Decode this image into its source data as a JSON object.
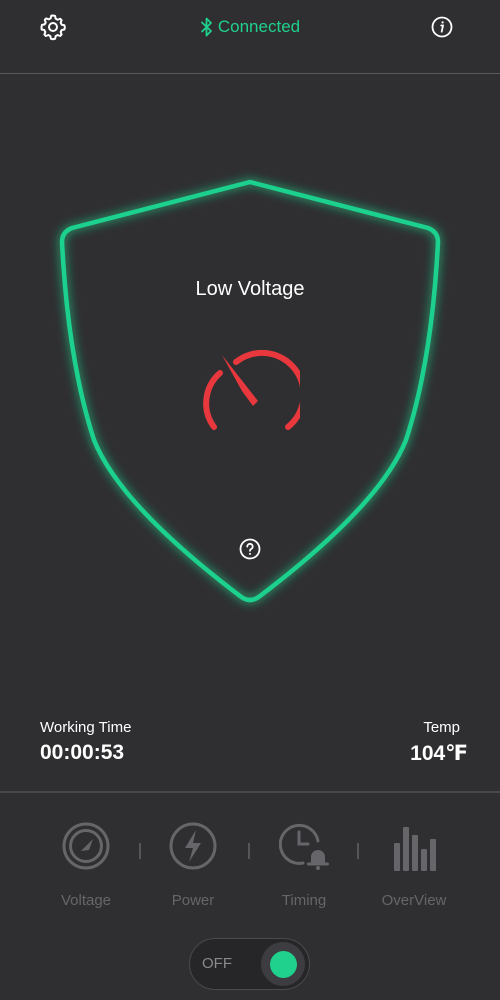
{
  "header": {
    "status_label": "Connected",
    "status_icon": "bluetooth-icon",
    "settings_icon": "gear-icon",
    "info_icon": "info-icon"
  },
  "main": {
    "state_label": "Low Voltage",
    "gauge_icon": "speedometer-icon",
    "help_icon": "question-icon"
  },
  "metrics": {
    "working_time": {
      "label": "Working Time",
      "value": "00:00:53"
    },
    "temp": {
      "label": "Temp",
      "value": "104℉"
    }
  },
  "nav": {
    "items": [
      {
        "label": "Voltage",
        "icon": "gauge-icon"
      },
      {
        "label": "Power",
        "icon": "lightning-icon"
      },
      {
        "label": "Timing",
        "icon": "clock-alarm-icon"
      },
      {
        "label": "OverView",
        "icon": "bar-chart-icon"
      }
    ]
  },
  "power_toggle": {
    "label": "OFF",
    "state": "off"
  },
  "colors": {
    "background": "#2f2f31",
    "accent": "#1fd18d",
    "alert": "#e8383d",
    "muted": "#66666a"
  }
}
